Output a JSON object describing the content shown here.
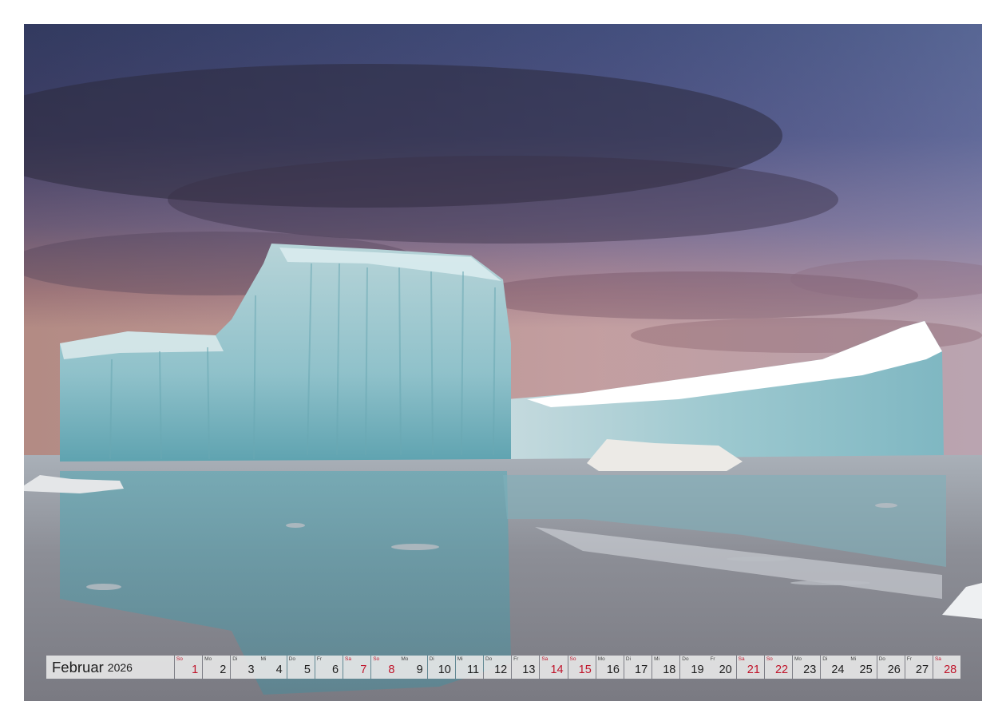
{
  "calendar": {
    "month": "Februar",
    "year": "2026",
    "days": [
      {
        "dow": "So",
        "num": "1",
        "weekend": true
      },
      {
        "dow": "Mo",
        "num": "2",
        "weekend": false
      },
      {
        "dow": "Di",
        "num": "3",
        "weekend": false
      },
      {
        "dow": "Mi",
        "num": "4",
        "weekend": false
      },
      {
        "dow": "Do",
        "num": "5",
        "weekend": false
      },
      {
        "dow": "Fr",
        "num": "6",
        "weekend": false
      },
      {
        "dow": "Sa",
        "num": "7",
        "weekend": true
      },
      {
        "dow": "So",
        "num": "8",
        "weekend": true
      },
      {
        "dow": "Mo",
        "num": "9",
        "weekend": false
      },
      {
        "dow": "Di",
        "num": "10",
        "weekend": false
      },
      {
        "dow": "Mi",
        "num": "11",
        "weekend": false
      },
      {
        "dow": "Do",
        "num": "12",
        "weekend": false
      },
      {
        "dow": "Fr",
        "num": "13",
        "weekend": false
      },
      {
        "dow": "Sa",
        "num": "14",
        "weekend": true
      },
      {
        "dow": "So",
        "num": "15",
        "weekend": true
      },
      {
        "dow": "Mo",
        "num": "16",
        "weekend": false
      },
      {
        "dow": "Di",
        "num": "17",
        "weekend": false
      },
      {
        "dow": "Mi",
        "num": "18",
        "weekend": false
      },
      {
        "dow": "Do",
        "num": "19",
        "weekend": false
      },
      {
        "dow": "Fr",
        "num": "20",
        "weekend": false
      },
      {
        "dow": "Sa",
        "num": "21",
        "weekend": true
      },
      {
        "dow": "So",
        "num": "22",
        "weekend": true
      },
      {
        "dow": "Mo",
        "num": "23",
        "weekend": false
      },
      {
        "dow": "Di",
        "num": "24",
        "weekend": false
      },
      {
        "dow": "Mi",
        "num": "25",
        "weekend": false
      },
      {
        "dow": "Do",
        "num": "26",
        "weekend": false
      },
      {
        "dow": "Fr",
        "num": "27",
        "weekend": false
      },
      {
        "dow": "Sa",
        "num": "28",
        "weekend": true
      }
    ]
  },
  "colors": {
    "weekend": "#c0142a",
    "text": "#1d1d1d",
    "cell_background": "#ebebeb"
  }
}
